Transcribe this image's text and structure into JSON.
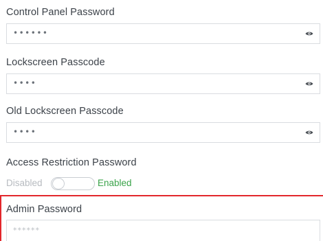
{
  "fields": {
    "control_panel": {
      "label": "Control Panel Password",
      "value": "••••••"
    },
    "lockscreen": {
      "label": "Lockscreen Passcode",
      "value": "••••"
    },
    "old_lockscreen": {
      "label": "Old Lockscreen Passcode",
      "value": "••••"
    },
    "admin": {
      "label": "Admin Password",
      "placeholder": "******"
    }
  },
  "access_restriction": {
    "label": "Access Restriction Password",
    "off_label": "Disabled",
    "on_label": "Enabled",
    "state": "disabled"
  },
  "icons": {
    "reveal": "eye-icon"
  },
  "colors": {
    "highlight": "#e2262b",
    "enabled": "#3aa34a",
    "disabled": "#b7bbc0"
  }
}
